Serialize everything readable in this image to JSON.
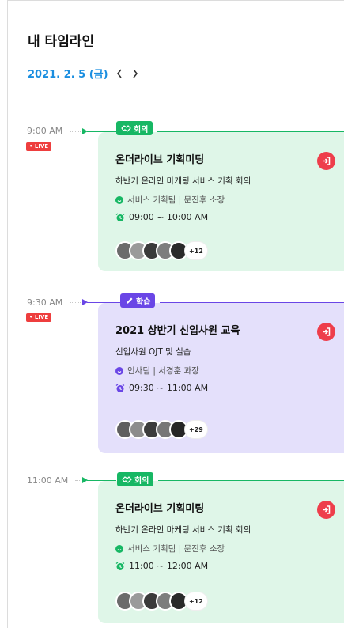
{
  "header": {
    "title": "내 타임라인"
  },
  "date_nav": {
    "date": "2021. 2. 5 (금)",
    "prev_glyph": "‹",
    "next_glyph": "›"
  },
  "events": [
    {
      "time": "9:00 AM",
      "live": "• LIVE",
      "tag": "회의",
      "tag_icon": "handshake-icon",
      "color": "#17b764",
      "title": "온더라이브 기획미팅",
      "subtitle": "하반기 온라인 마케팅 서비스 기획 회의",
      "organizer": "서비스 기획팀 | 문진후 소장",
      "time_range": "09:00 ~ 10:00 AM",
      "more_count": "+12"
    },
    {
      "time": "9:30 AM",
      "live": "• LIVE",
      "tag": "학습",
      "tag_icon": "pencil-icon",
      "color": "#6a46e6",
      "title": "2021 상반기 신입사원 교육",
      "subtitle": "신입사원 OJT 및 실습",
      "organizer": "인사팀 | 서경훈 과장",
      "time_range": "09:30 ~ 11:00 AM",
      "more_count": "+29"
    },
    {
      "time": "11:00 AM",
      "live": "",
      "tag": "회의",
      "tag_icon": "handshake-icon",
      "color": "#17b764",
      "title": "온더라이브 기획미팅",
      "subtitle": "하반기 온라인 마케팅 서비스 기획 회의",
      "organizer": "서비스 기획팀 | 문진후 소장",
      "time_range": "11:00 ~ 12:00 AM",
      "more_count": "+12"
    }
  ]
}
